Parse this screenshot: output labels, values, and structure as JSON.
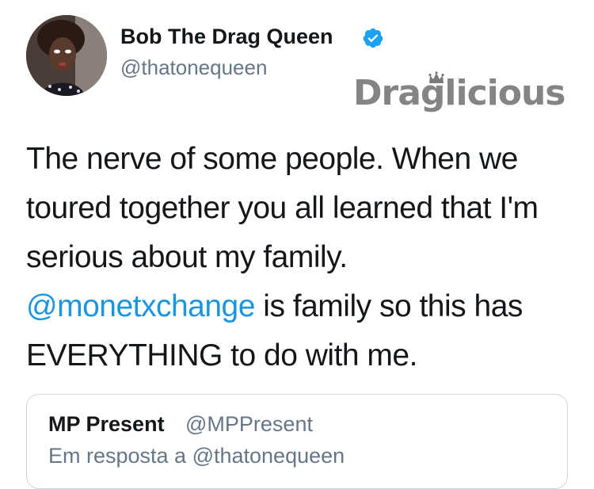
{
  "tweet": {
    "author": {
      "name": "Bob The Drag Queen",
      "handle": "@thatonequeen",
      "verified": true
    },
    "text_lines": [
      "The nerve of some people. When we",
      "toured together you all learned that I'm",
      "serious about my family."
    ],
    "mention": "@monetxchange",
    "mention_rest": " is family so this has",
    "last_line": "EVERYTHING to do with me."
  },
  "quoted_tweet": {
    "name": "MP Present",
    "handle": "@MPPresent",
    "reply_to": "Em resposta a @thatonequeen"
  },
  "watermark": {
    "text": "Draglicious"
  },
  "colors": {
    "link": "#1b95e0",
    "secondary_text": "#657786",
    "verified_badge": "#1da1f2",
    "border": "#ccd6dd"
  },
  "icons": {
    "verified": "verified-badge-icon",
    "crown": "crown-icon"
  }
}
